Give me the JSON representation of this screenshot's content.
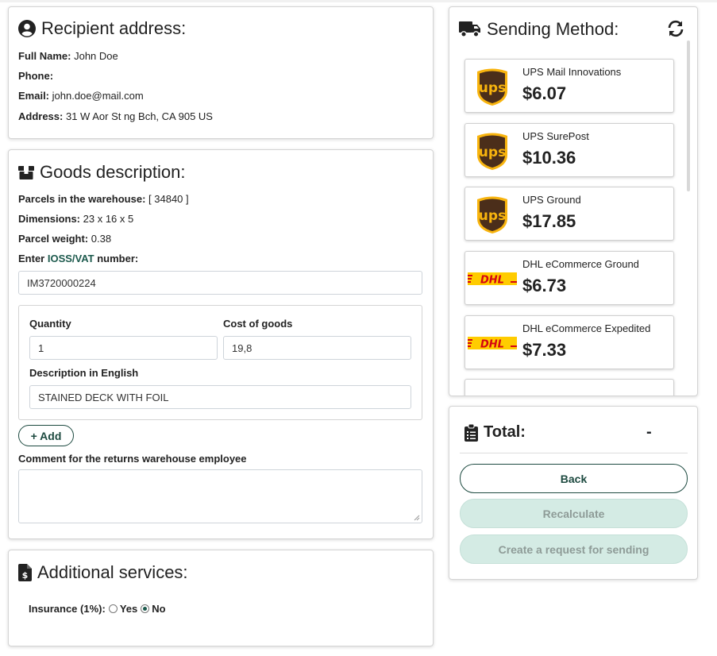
{
  "recipient": {
    "title": "Recipient address:",
    "full_name_label": "Full Name:",
    "full_name": "John Doe",
    "phone_label": "Phone:",
    "phone": "",
    "email_label": "Email:",
    "email": "john.doe@mail.com",
    "address_label": "Address:",
    "address": "31 W Aor St ng Bch, CA 905 US"
  },
  "goods": {
    "title": "Goods description:",
    "parcels_label": "Parcels in the warehouse:",
    "parcels": "[ 34840 ]",
    "dimensions_label": "Dimensions:",
    "dimensions": "23 x 16 x 5",
    "weight_label": "Parcel weight:",
    "weight": "0.38",
    "ioss_prefix": "Enter",
    "ioss_link": "IOSS/VAT",
    "ioss_suffix": "number:",
    "ioss_value": "IM3720000224",
    "quantity_label": "Quantity",
    "quantity": "1",
    "cost_label": "Cost of goods",
    "cost": "19,8",
    "description_label": "Description in English",
    "description": "STAINED DECK WITH FOIL",
    "add_label": "+ Add",
    "comment_label": "Comment for the returns warehouse employee",
    "comment": ""
  },
  "services": {
    "title": "Additional services:",
    "insurance_label": "Insurance (1%):",
    "yes_label": "Yes",
    "no_label": "No",
    "selected": "No"
  },
  "sending": {
    "title": "Sending Method:",
    "options": [
      {
        "carrier": "UPS",
        "name": "UPS Mail Innovations",
        "price": "$6.07"
      },
      {
        "carrier": "UPS",
        "name": "UPS SurePost",
        "price": "$10.36"
      },
      {
        "carrier": "UPS",
        "name": "UPS Ground",
        "price": "$17.85"
      },
      {
        "carrier": "DHL",
        "name": "DHL eCommerce Ground",
        "price": "$6.73"
      },
      {
        "carrier": "DHL",
        "name": "DHL eCommerce Expedited",
        "price": "$7.33"
      }
    ]
  },
  "total": {
    "title": "Total:",
    "value": "-",
    "back_label": "Back",
    "recalculate_label": "Recalculate",
    "create_label": "Create a request for sending"
  },
  "icons": {
    "recipient": "user-circle-icon",
    "goods": "box-icon",
    "services": "dollar-file-icon",
    "sending": "truck-icon",
    "refresh": "refresh-icon",
    "total": "clipboard-icon"
  },
  "colors": {
    "accent": "#1d4a40",
    "link": "#1d5a4d",
    "disabled_btn": "#d4ebe4",
    "ups_brown": "#4b2e1a",
    "ups_gold": "#f8b40e",
    "dhl_yellow": "#ffcc00",
    "dhl_red": "#d40511"
  }
}
